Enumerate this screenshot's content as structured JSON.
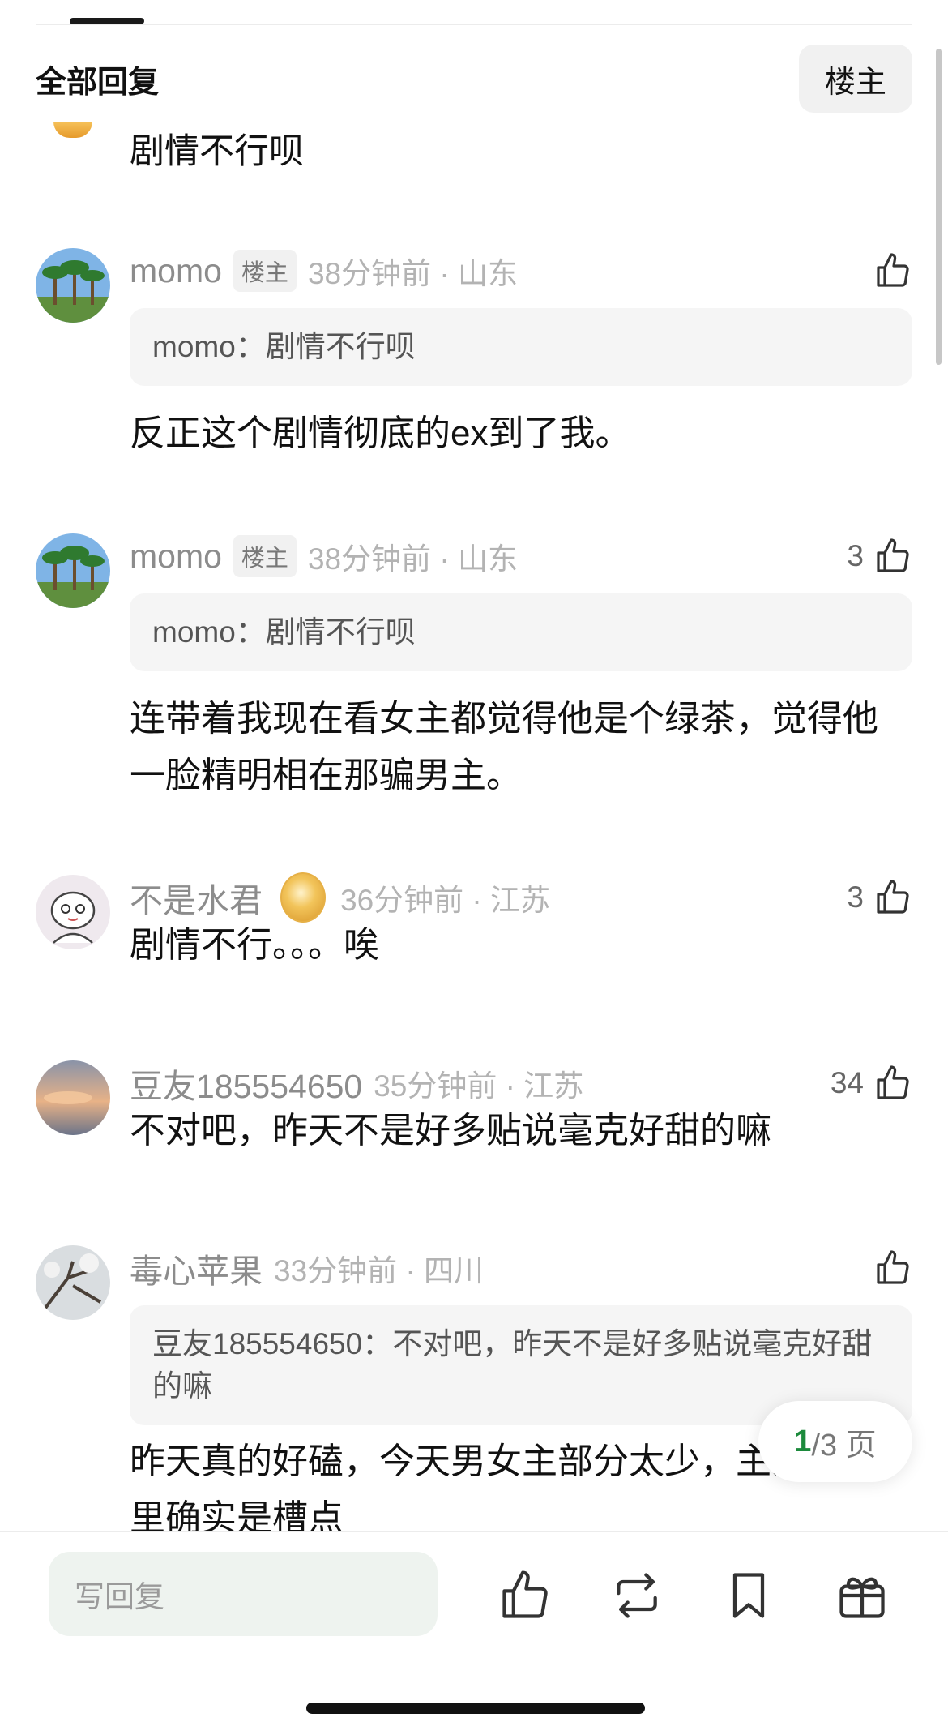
{
  "header": {
    "title": "全部回复",
    "op_filter_label": "楼主"
  },
  "partial_comment": {
    "text": "剧情不行呗"
  },
  "comments": [
    {
      "username": "momo",
      "badge": "楼主",
      "time_location": "38分钟前 · 山东",
      "likes": "",
      "quote": "momo：剧情不行呗",
      "text": "反正这个剧情彻底的ex到了我。"
    },
    {
      "username": "momo",
      "badge": "楼主",
      "time_location": "38分钟前 · 山东",
      "likes": "3",
      "quote": "momo：剧情不行呗",
      "text": "连带着我现在看女主都觉得他是个绿茶，觉得他一脸精明相在那骗男主。"
    },
    {
      "username": "不是水君",
      "time_location": "36分钟前 · 江苏",
      "likes": "3",
      "text": "剧情不行。。。唉"
    },
    {
      "username": "豆友185554650",
      "time_location": "35分钟前 · 江苏",
      "likes": "34",
      "text": "不对吧，昨天不是好多贴说毫克好甜的嘛"
    },
    {
      "username": "毒心苹果",
      "time_location": "33分钟前 · 四川",
      "likes": "",
      "quote": "豆友185554650：不对吧，昨天不是好多贴说毫克好甜的嘛",
      "text": "昨天真的好磕，今天男女主部分太少，主弟弟那里确实是槽点"
    }
  ],
  "pagination": {
    "current": "1",
    "total": "/3 页"
  },
  "bottom_bar": {
    "reply_placeholder": "写回复",
    "icons": [
      "like-icon",
      "repost-icon",
      "bookmark-icon",
      "gift-icon"
    ]
  },
  "colors": {
    "accent_green": "#1c8a3c",
    "quote_bg": "#f5f5f5",
    "reply_bg": "#eef3ef"
  }
}
